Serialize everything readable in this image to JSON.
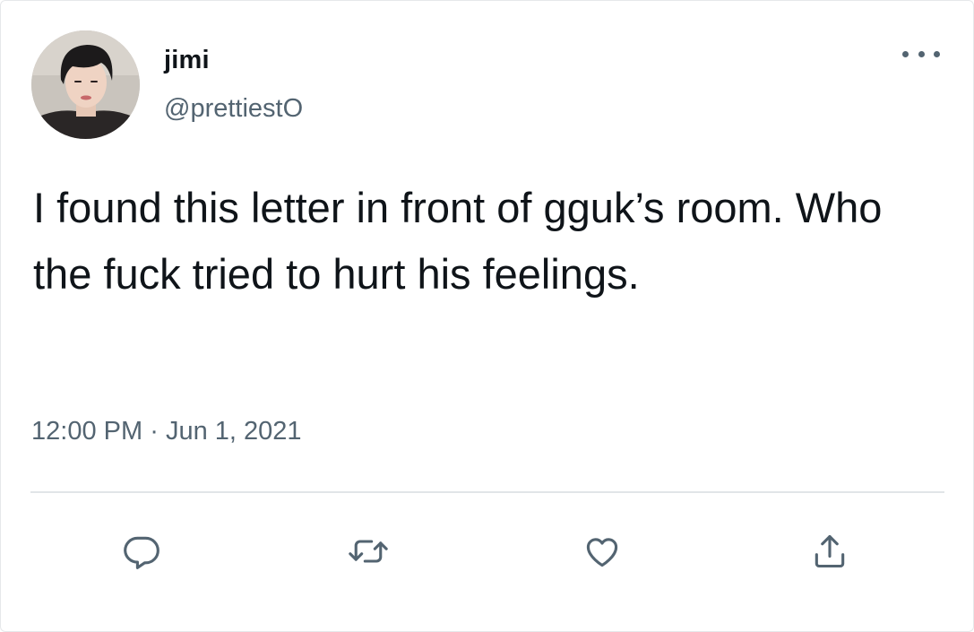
{
  "author": {
    "display_name": "jimi",
    "handle": "@prettiestO"
  },
  "tweet": {
    "text": "I found this letter in front of gguk’s room. Who the fuck tried to hurt his feelings.",
    "time": "12:00 PM",
    "separator": "·",
    "date": "Jun 1, 2021"
  },
  "actions": {
    "reply_icon": "reply-bubble-icon",
    "retweet_icon": "retweet-icon",
    "like_icon": "heart-icon",
    "share_icon": "share-upload-icon",
    "more_icon": "more-dots-icon"
  },
  "colors": {
    "text_primary": "#0f1419",
    "text_secondary": "#536471",
    "divider": "#e1e5e8",
    "icon": "#536471"
  }
}
